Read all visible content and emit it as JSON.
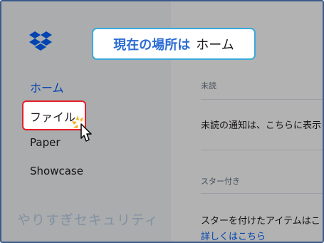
{
  "callout": {
    "bold_text": "現在の場所は",
    "location_text": "ホーム"
  },
  "sidebar": {
    "logo_icon": "dropbox-logo-icon",
    "items": [
      {
        "label": "ホーム",
        "active": true
      },
      {
        "label": "ファイル",
        "highlighted": true
      },
      {
        "label": "Paper"
      },
      {
        "label": "Showcase"
      }
    ]
  },
  "main": {
    "unread_heading": "未読",
    "unread_message": "未読の通知は、こちらに表示",
    "starred_heading": "スター付き",
    "starred_message": "スターを付けたアイテムはこ",
    "learn_more_link": "詳しくはこちら"
  },
  "watermark": "やりすぎセキュリティ",
  "colors": {
    "active_nav": "#0061fe",
    "highlight_border": "#e5202a",
    "callout_border": "#39a9dc",
    "callout_text": "#2b6cd3",
    "frame_border": "#3c5a8c"
  },
  "cursor_icon": "pointer-hand-click-icon"
}
